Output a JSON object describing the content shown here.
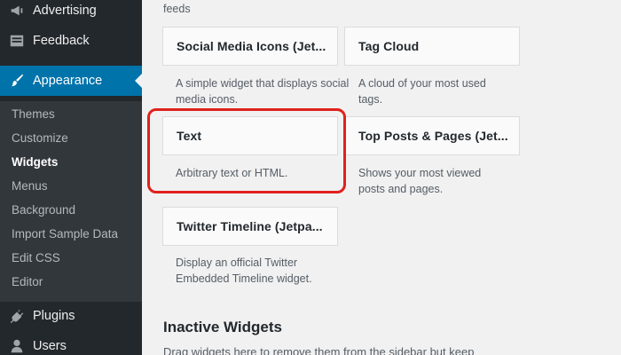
{
  "sidebar": {
    "menu": [
      {
        "label": "Advertising",
        "icon": "megaphone-icon"
      },
      {
        "label": "Feedback",
        "icon": "feedback-icon"
      },
      {
        "label": "Appearance",
        "icon": "paintbrush-icon"
      },
      {
        "label": "Plugins",
        "icon": "plugin-icon"
      },
      {
        "label": "Users",
        "icon": "users-icon"
      }
    ],
    "submenu": [
      "Themes",
      "Customize",
      "Widgets",
      "Menus",
      "Background",
      "Import Sample Data",
      "Edit CSS",
      "Editor"
    ],
    "current_submenu": "Widgets",
    "accent_color": "#0073aa"
  },
  "widgets": {
    "top_fragment": "feeds",
    "items": [
      {
        "title": "Social Media Icons (Jet...",
        "description": "A simple widget that displays social media icons."
      },
      {
        "title": "Tag Cloud",
        "description": "A cloud of your most used tags."
      },
      {
        "title": "Text",
        "description": "Arbitrary text or HTML."
      },
      {
        "title": "Top Posts & Pages (Jet...",
        "description": "Shows your most viewed posts and pages."
      },
      {
        "title": "Twitter Timeline (Jetpa...",
        "description": "Display an official Twitter Embedded Timeline widget."
      }
    ],
    "highlight_color": "#e0211c"
  },
  "inactive": {
    "title": "Inactive Widgets",
    "description": "Drag widgets here to remove them from the sidebar but keep"
  }
}
